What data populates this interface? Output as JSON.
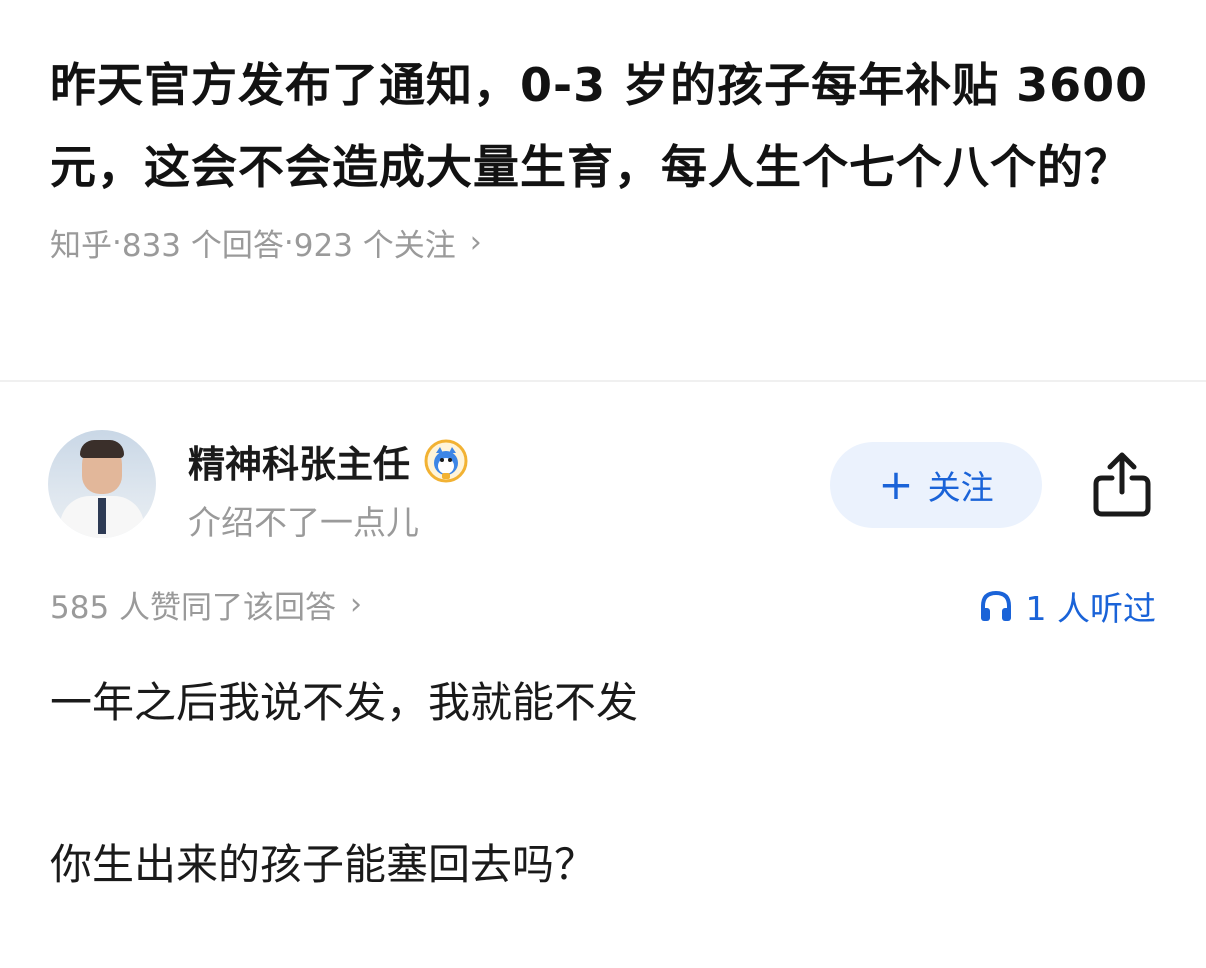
{
  "question": {
    "title": "昨天官方发布了通知，0-3 岁的孩子每年补贴 3600 元，这会不会造成大量生育，每人生个七个八个的？",
    "source": "知乎",
    "answers_count": "833 个回答",
    "followers_count": "923 个关注",
    "separator": " · ",
    "chevron": "›"
  },
  "author": {
    "name": "精神科张主任",
    "bio": "介绍不了一点儿",
    "badge_icon": "badge-icon",
    "avatar_icon": "avatar"
  },
  "actions": {
    "follow_plus": "+",
    "follow_label": "关注",
    "share_icon": "share-icon"
  },
  "stats": {
    "likes": "585 人赞同了该回答",
    "chevron": "›",
    "listeners": "1 人听过",
    "listeners_icon": "headphones-icon"
  },
  "answer": {
    "paragraphs": [
      "一年之后我说不发，我就能不发",
      "你生出来的孩子能塞回去吗？"
    ]
  },
  "colors": {
    "accent": "#1a63d8",
    "follow_bg": "#ebf2fd",
    "muted": "#9a9a9a",
    "text": "#1a1a1a"
  }
}
